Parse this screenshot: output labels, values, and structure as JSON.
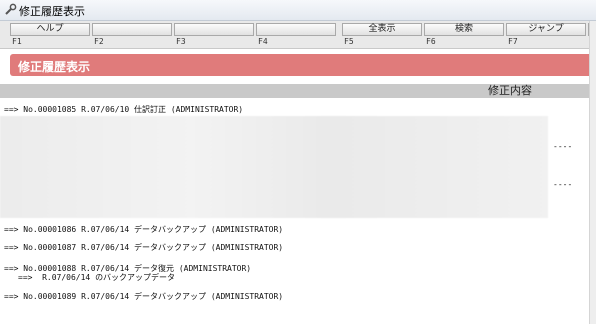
{
  "window": {
    "title": "修正履歴表示",
    "icon": "wrench-icon"
  },
  "fkeys": [
    {
      "label": "ヘルプ",
      "key": "F1"
    },
    {
      "label": "",
      "key": "F2"
    },
    {
      "label": "",
      "key": "F3"
    },
    {
      "label": "",
      "key": "F4"
    },
    {
      "label": "全表示",
      "key": "F5"
    },
    {
      "label": "検索",
      "key": "F6"
    },
    {
      "label": "ジャンプ",
      "key": "F7"
    },
    {
      "label": "",
      "key": "F"
    }
  ],
  "header": {
    "title": "修正履歴表示",
    "band_color": "#e07b7b"
  },
  "column": {
    "label": "修正内容"
  },
  "entries": [
    {
      "line": "==> No.00001085 R.07/06/10 仕訳訂正 (ADMINISTRATOR)"
    },
    {
      "line": "==> No.00001086 R.07/06/14 データバックアップ (ADMINISTRATOR)"
    },
    {
      "line": "==> No.00001087 R.07/06/14 データバックアップ (ADMINISTRATOR)"
    },
    {
      "line": "==> No.00001088 R.07/06/14 データ復元 (ADMINISTRATOR)",
      "sub": "==>  R.07/06/14 のバックアップデータ"
    },
    {
      "line": "==> No.00001089 R.07/06/14 データバックアップ (ADMINISTRATOR)"
    }
  ],
  "dashes": [
    "----",
    "----"
  ]
}
